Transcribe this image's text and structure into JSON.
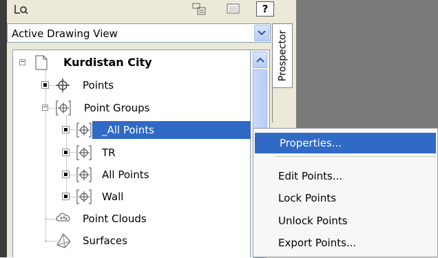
{
  "dropdown": {
    "value": "Active Drawing View"
  },
  "prospector_tab": {
    "label": "Prospector"
  },
  "toolbar": {
    "help_label": "?"
  },
  "tree": {
    "root": "Kurdistan City",
    "points": "Points",
    "point_groups": "Point Groups",
    "groups": [
      "_All Points",
      "TR",
      "All Points",
      "Wall"
    ],
    "point_clouds": "Point Clouds",
    "surfaces": "Surfaces"
  },
  "context_menu": {
    "items": [
      "Properties...",
      "Edit Points...",
      "Lock Points",
      "Unlock Points",
      "Export Points..."
    ]
  },
  "colors": {
    "selection": "#316ac5",
    "panel": "#ece9d8"
  }
}
